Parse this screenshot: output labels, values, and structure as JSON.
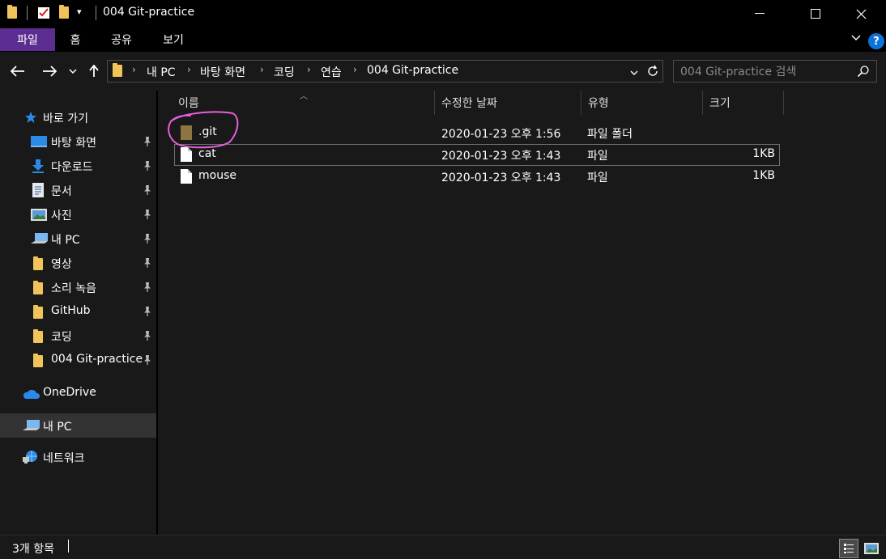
{
  "window": {
    "title": "004 Git-practice",
    "minimize": "—",
    "maximize": "☐",
    "close": "✕"
  },
  "ribbon": {
    "tabs": [
      "파일",
      "홈",
      "공유",
      "보기"
    ],
    "help": "?"
  },
  "nav": {
    "back": "←",
    "forward": "→",
    "recent": "⌄",
    "up": "↑",
    "breadcrumbs": [
      "내 PC",
      "바탕 화면",
      "코딩",
      "연습",
      "004 Git-practice"
    ],
    "search_placeholder": "004 Git-practice 검색"
  },
  "sidebar": {
    "quick_access": "바로 가기",
    "items": [
      {
        "label": "바탕 화면",
        "icon": "desktop-icon",
        "pinned": true
      },
      {
        "label": "다운로드",
        "icon": "download-icon",
        "pinned": true
      },
      {
        "label": "문서",
        "icon": "document-icon",
        "pinned": true
      },
      {
        "label": "사진",
        "icon": "pictures-icon",
        "pinned": true
      },
      {
        "label": "내 PC",
        "icon": "pc-icon",
        "pinned": true
      },
      {
        "label": "영상",
        "icon": "folder-icon",
        "pinned": true
      },
      {
        "label": "소리 녹음",
        "icon": "folder-icon",
        "pinned": true
      },
      {
        "label": "GitHub",
        "icon": "folder-icon",
        "pinned": true
      },
      {
        "label": "코딩",
        "icon": "folder-icon",
        "pinned": true
      },
      {
        "label": "004 Git-practice",
        "icon": "folder-icon",
        "pinned": true
      }
    ],
    "onedrive": "OneDrive",
    "this_pc": "내 PC",
    "network": "네트워크"
  },
  "columns": {
    "name": "이름",
    "modified": "수정한 날짜",
    "type": "유형",
    "size": "크기"
  },
  "files": [
    {
      "name": ".git",
      "modified": "2020-01-23 오후 1:56",
      "type": "파일 폴더",
      "size": ""
    },
    {
      "name": "cat",
      "modified": "2020-01-23 오후 1:43",
      "type": "파일",
      "size": "1KB"
    },
    {
      "name": "mouse",
      "modified": "2020-01-23 오후 1:43",
      "type": "파일",
      "size": "1KB"
    }
  ],
  "status": {
    "count_text": "3개 항목"
  },
  "colors": {
    "accent_file_tab": "#5c2d91",
    "annotation_circle": "#e85fe0",
    "help_blue": "#0a74da",
    "folder_yellow": "#f0c45a"
  }
}
